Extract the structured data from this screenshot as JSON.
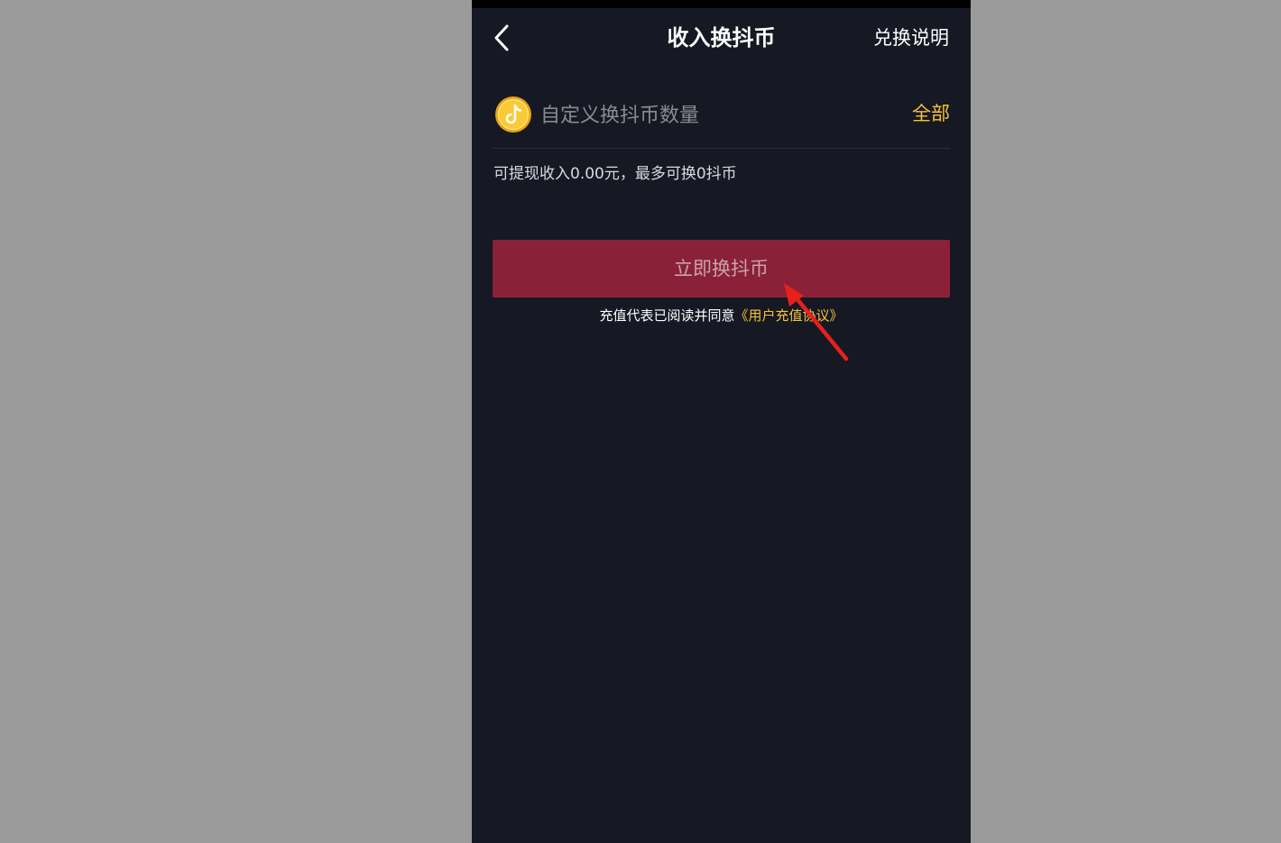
{
  "header": {
    "title": "收入换抖币",
    "action_label": "兑换说明"
  },
  "exchange_form": {
    "amount_placeholder": "自定义换抖币数量",
    "all_label": "全部",
    "balance_text": "可提现收入0.00元，最多可换0抖币",
    "submit_label": "立即换抖币",
    "agreement_prefix": "充值代表已阅读并同意",
    "agreement_link": "《用户充值协议》"
  },
  "icons": {
    "back": "chevron-left-icon",
    "coin": "douyin-coin-icon",
    "annotation": "red-arrow-icon"
  },
  "colors": {
    "page_background": "#161823",
    "accent_gold": "#f5c33b",
    "button_disabled": "#8a2139",
    "annotation_red": "#e8201b"
  }
}
